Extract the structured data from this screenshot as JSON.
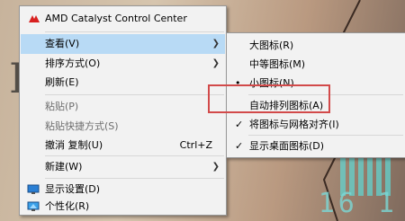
{
  "main_menu": {
    "items": [
      {
        "label": "AMD Catalyst Control Center",
        "icon": "amd-icon"
      },
      {
        "label": "查看(V)",
        "submenu": true
      },
      {
        "label": "排序方式(O)",
        "submenu": true
      },
      {
        "label": "刷新(E)"
      },
      {
        "label": "粘贴(P)",
        "disabled": true
      },
      {
        "label": "粘贴快捷方式(S)",
        "disabled": true
      },
      {
        "label": "撤消 复制(U)",
        "shortcut": "Ctrl+Z"
      },
      {
        "label": "新建(W)",
        "submenu": true
      },
      {
        "label": "显示设置(D)",
        "icon": "display-settings-icon"
      },
      {
        "label": "个性化(R)",
        "icon": "personalize-icon"
      }
    ]
  },
  "view_submenu": {
    "items": [
      {
        "label": "大图标(R)",
        "mark": ""
      },
      {
        "label": "中等图标(M)",
        "mark": ""
      },
      {
        "label": "小图标(N)",
        "mark": "•"
      },
      {
        "label": "自动排列图标(A)",
        "mark": ""
      },
      {
        "label": "将图标与网格对齐(I)",
        "mark": "✓"
      },
      {
        "label": "显示桌面图标(D)",
        "mark": "✓"
      }
    ]
  },
  "colors": {
    "highlight_box": "#d24a4a",
    "hover": "#91c9f7",
    "menu_bg": "#f2f2f2"
  },
  "wallpaper": {
    "digits": "16 1"
  }
}
